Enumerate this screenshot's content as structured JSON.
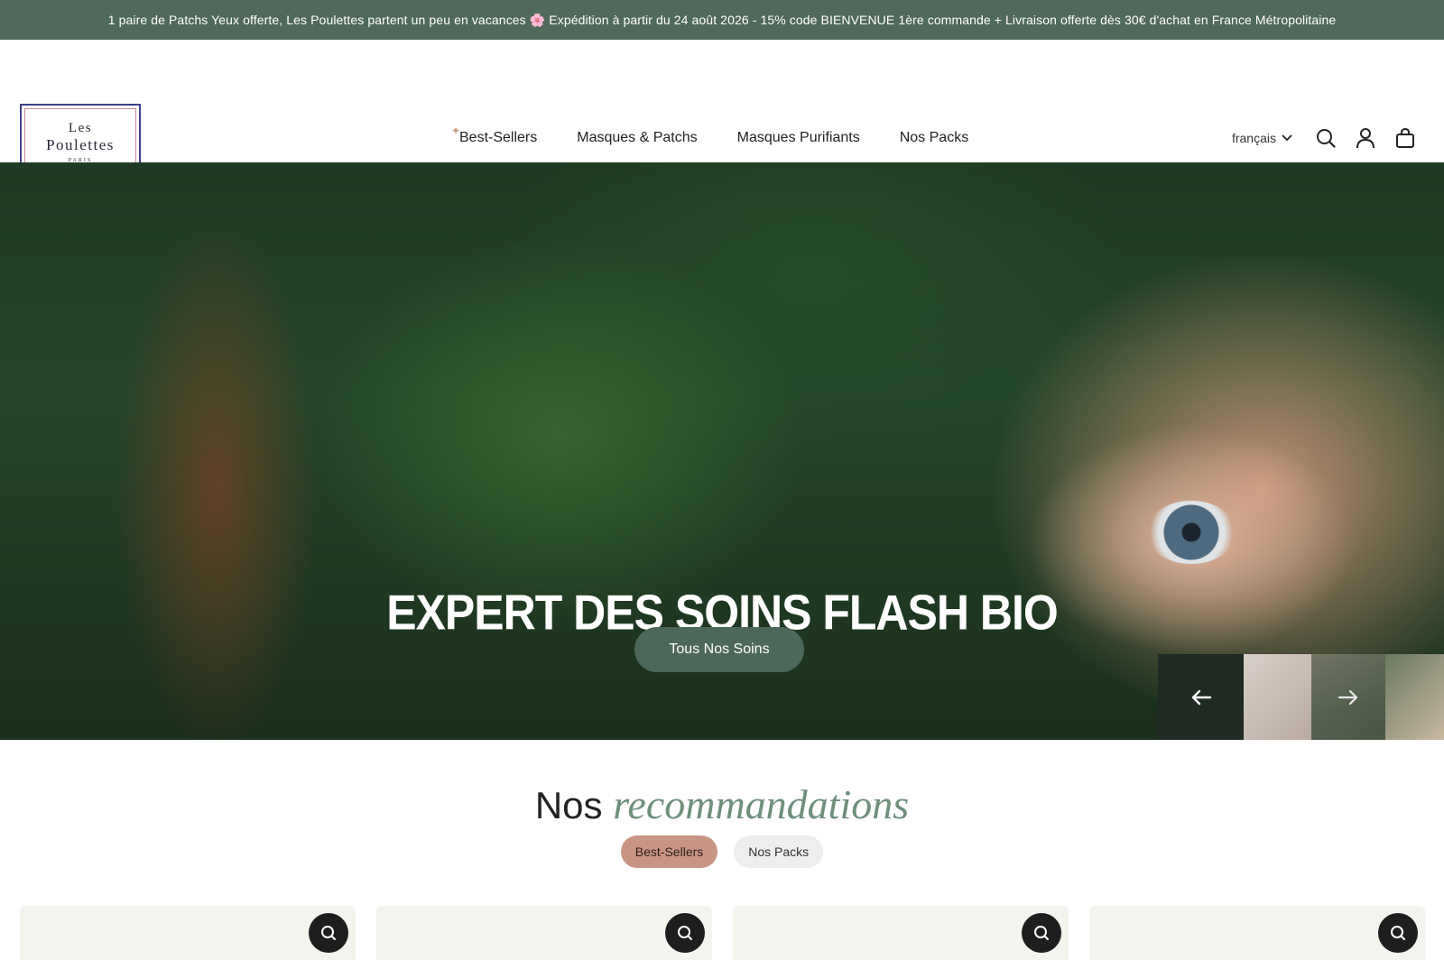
{
  "announcement": {
    "text": "1 paire de Patchs Yeux offerte, Les Poulettes partent un peu en vacances 🌸 Expédition à partir du 24 août 2026 - 15% code BIENVENUE 1ère commande + Livraison offerte dès 30€ d'achat en France Métropolitaine"
  },
  "header": {
    "logo": {
      "line1": "Les",
      "line2": "Poulettes",
      "line3": "PARIS"
    },
    "nav": [
      "Best-Sellers",
      "Masques & Patchs",
      "Masques Purifiants",
      "Nos Packs"
    ],
    "language": "français",
    "icons": [
      "search-icon",
      "account-icon",
      "cart-icon"
    ]
  },
  "hero": {
    "title": "EXPERT DES SOINS FLASH BIO",
    "cta": "Tous Nos Soins"
  },
  "recommendations": {
    "title_plain": "Nos",
    "title_accent": "recommandations",
    "tabs": [
      {
        "label": "Best-Sellers",
        "active": true
      },
      {
        "label": "Nos Packs",
        "active": false
      }
    ]
  },
  "colors": {
    "announcement_bg": "#4f6a5a",
    "cta_bg": "#4c685a",
    "tab_active": "#c99583",
    "accent_text": "#6e8f7c",
    "card_bg": "#f3f4ee"
  }
}
